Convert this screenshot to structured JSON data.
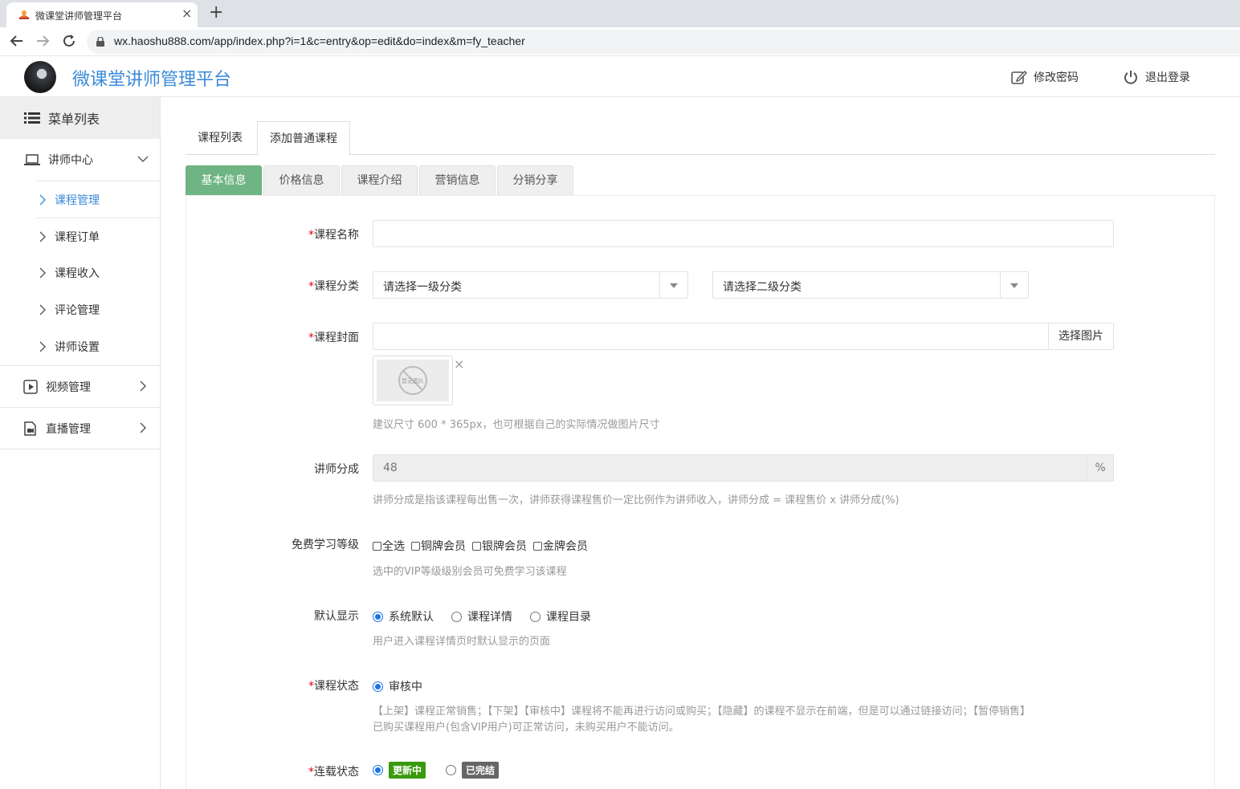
{
  "browser": {
    "tab_title": "微课堂讲师管理平台",
    "tab_close": "×",
    "new_tab": "+",
    "url": "wx.haoshu888.com/app/index.php?i=1&c=entry&op=edit&do=index&m=fy_teacher"
  },
  "header": {
    "title": "微课堂讲师管理平台",
    "change_password": "修改密码",
    "logout": "退出登录"
  },
  "sidebar": {
    "menu_title": "菜单列表",
    "teacher_center": "讲师中心",
    "teacher_items": [
      "课程管理",
      "课程订单",
      "课程收入",
      "评论管理",
      "讲师设置"
    ],
    "active_item": "课程管理",
    "video_manage": "视频管理",
    "live_manage": "直播管理"
  },
  "tabs": {
    "course_list": "课程列表",
    "add_course": "添加普通课程"
  },
  "subtabs": [
    "基本信息",
    "价格信息",
    "课程介绍",
    "营销信息",
    "分销分享"
  ],
  "form": {
    "required_mark": "*",
    "course_name_label": "课程名称",
    "course_name_value": "",
    "category_label": "课程分类",
    "category1_placeholder": "请选择一级分类",
    "category2_placeholder": "请选择二级分类",
    "cover_label": "课程封面",
    "choose_image": "选择图片",
    "no_image_text": "暂无图片",
    "remove_image": "×",
    "cover_help": "建议尺寸 600 * 365px，也可根据自己的实际情况做图片尺寸",
    "share_label": "讲师分成",
    "share_value": "48",
    "share_unit": "%",
    "share_help": "讲师分成是指该课程每出售一次，讲师获得课程售价一定比例作为讲师收入，讲师分成 = 课程售价 x 讲师分成(%)",
    "free_level_label": "免费学习等级",
    "free_levels": [
      "全选",
      "铜牌会员",
      "银牌会员",
      "金牌会员"
    ],
    "free_level_help": "选中的VIP等级级别会员可免费学习该课程",
    "default_display_label": "默认显示",
    "default_display_options": [
      "系统默认",
      "课程详情",
      "课程目录"
    ],
    "default_display_selected": "系统默认",
    "default_display_help": "用户进入课程详情页时默认显示的页面",
    "status_label": "课程状态",
    "status_option": "审核中",
    "status_help_1": "【上架】课程正常销售；【下架】【审核中】课程将不能再进行访问或购买；【隐藏】的课程不显示在前端，但是可以通过链接访问；【暂停销售】",
    "status_help_2": "已购买课程用户(包含VIP用户)可正常访问，未购买用户不能访问。",
    "serial_label": "连载状态",
    "serial_options": [
      "更新中",
      "已完结"
    ],
    "serial_selected": "更新中"
  },
  "colors": {
    "brand_blue": "#3b8ad9",
    "active_subtab": "#6fb483",
    "required_red": "#e60012",
    "badge_green": "#3a9a0f",
    "badge_gray": "#666666"
  }
}
